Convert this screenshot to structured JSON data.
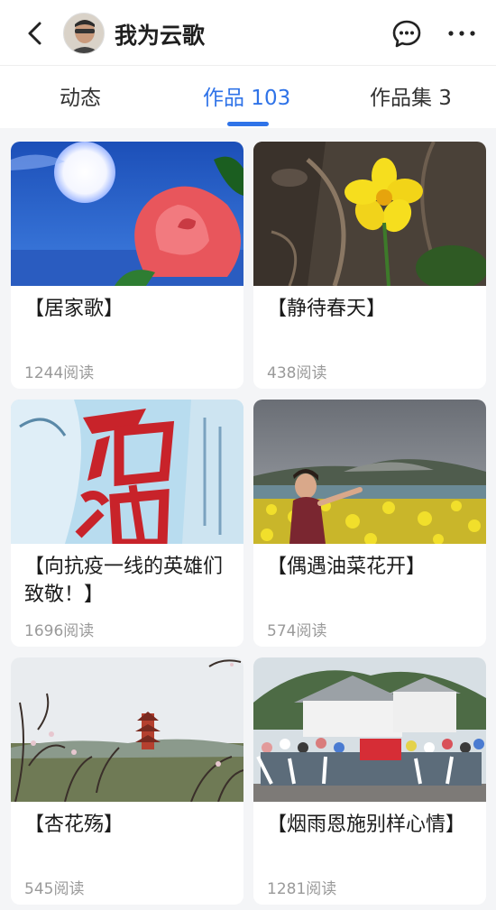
{
  "header": {
    "username": "我为云歌",
    "back_icon": "chevron-left-icon",
    "message_icon": "chat-bubble-icon",
    "more_icon": "more-horizontal-icon"
  },
  "tabs": [
    {
      "label": "动态",
      "active": false
    },
    {
      "label": "作品 103",
      "active": true
    },
    {
      "label": "作品集 3",
      "active": false
    }
  ],
  "accent_color": "#2f73e8",
  "works": [
    {
      "title": "【居家歌】",
      "reads": "1244阅读"
    },
    {
      "title": "【静待春天】",
      "reads": "438阅读"
    },
    {
      "title": "【向抗疫一线的英雄们致敬！】",
      "reads": "1696阅读"
    },
    {
      "title": "【偶遇油菜花开】",
      "reads": "574阅读"
    },
    {
      "title": "【杏花殇】",
      "reads": "545阅读"
    },
    {
      "title": "【烟雨恩施别样心情】",
      "reads": "1281阅读"
    }
  ]
}
